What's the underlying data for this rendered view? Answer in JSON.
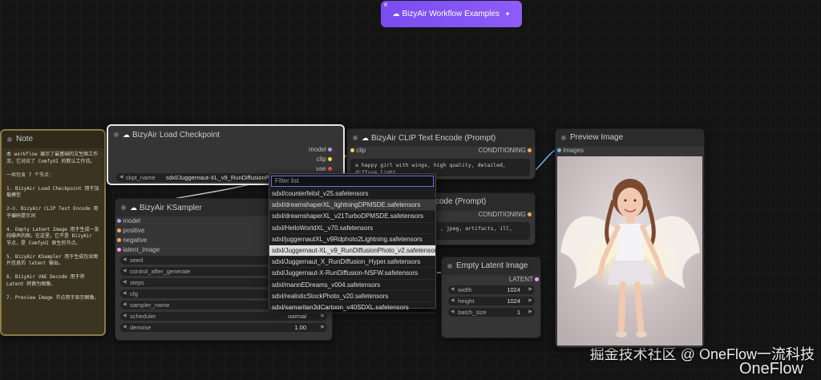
{
  "examples_button": {
    "label": "BizyAir Workflow Examples",
    "close": "×",
    "sparkle": "✦"
  },
  "note": {
    "title": "Note",
    "text": "本 workflow 展示了最基础的文生图工作流，它对应了 ComfyUI 的默认工作流。\n\n一共包含 7 个节点：\n\n1. BizyAir Load Checkpoint 用于加载模型\n\n2~3. BizyAir CLIP Text Encode 用于编码提示词\n\n4. Empty Latent Image 用于生成一张纯噪声的图，在这里，它不是 BizyAir 节点，是 ComfyUI 原生的节点。\n\n5. BizyAir KSampler 用于生成包含图片信息的 latent 输出。\n\n6. BizyAir VAE Decode 用于将 Latent 转换为图像。\n\n7. Preview Image 节点用于显示图像。"
  },
  "load_checkpoint": {
    "title": "BizyAir Load Checkpoint",
    "outputs": [
      "model",
      "clip",
      "vae"
    ],
    "widget_label": "ckpt_name",
    "widget_value": "sdxl/Juggernaut-XL_v9_RunDiffusionPho..."
  },
  "clip_encode_pos": {
    "title": "BizyAir CLIP Text Encode (Prompt)",
    "input": "clip",
    "output": "CONDITIONING",
    "text": "a happy girl with wings, high quality, detailed, diffuse light"
  },
  "clip_encode_neg": {
    "title": "code (Prompt)",
    "output": "CONDITIONING",
    "text": ", jpeg, artifacts, ill,"
  },
  "ksampler": {
    "title": "BizyAir KSampler",
    "inputs": [
      "model",
      "positive",
      "negative",
      "latent_image"
    ],
    "widgets": [
      {
        "label": "seed",
        "value": "81"
      },
      {
        "label": "control_after_generate",
        "value": ""
      },
      {
        "label": "steps",
        "value": ""
      },
      {
        "label": "cfg",
        "value": ""
      },
      {
        "label": "sampler_name",
        "value": ""
      },
      {
        "label": "scheduler",
        "value": "normal"
      },
      {
        "label": "denoise",
        "value": "1.00"
      }
    ]
  },
  "empty_latent": {
    "title": "Empty Latent Image",
    "output": "LATENT",
    "widgets": [
      {
        "label": "width",
        "value": "1024"
      },
      {
        "label": "height",
        "value": "1024"
      },
      {
        "label": "batch_size",
        "value": "1"
      }
    ]
  },
  "preview": {
    "title": "Preview Image",
    "input": "images"
  },
  "dropdown": {
    "placeholder": "Filter list",
    "options": [
      "sdxl/counterfeitxl_v25.safetensors",
      "sdxl/dreamshaperXL_lightningDPMSDE.safetensors",
      "sdxl/dreamshaperXL_v21TurboDPMSDE.safetensors",
      "sdxl/HelloWorldXL_v70.safetensors",
      "sdxl/juggernautXL_v9Rdphoto2Lightning.safetensors",
      "sdxl/Juggernaut-XL_v9_RunDiffusionPhoto_v2.safetensors",
      "sdxl/Juggernaut_X_RunDiffusion_Hyper.safetensors",
      "sdxl/Juggernaut-X-RunDiffusion-NSFW.safetensors",
      "sdxl/mannEDreams_v004.safetensors",
      "sdxl/realisticStockPhoto_v20.safetensors",
      "sdxl/samaritan3dCartoon_v40SDXL.safetensors"
    ],
    "highlighted_index": 1,
    "selected_index": 5
  },
  "watermark": {
    "line1": "掘金技术社区 @ OneFlow一流科技",
    "line2": "OneFlow"
  },
  "colors": {
    "accent": "#8e5cf8",
    "model_pin": "#b39ddb",
    "clip_pin": "#ffd54f",
    "vae_pin": "#ef5350",
    "conditioning_pin": "#ffa94d",
    "latent_pin": "#ff9cf9",
    "image_pin": "#64b5f6",
    "link": "#a5b8c7",
    "note_bg": "#3a3420",
    "note_border": "#8b7a45"
  }
}
